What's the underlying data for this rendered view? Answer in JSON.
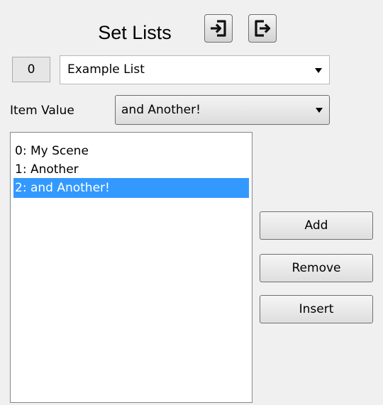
{
  "header": {
    "title": "Set Lists",
    "buttons": [
      {
        "icon": "import-icon"
      },
      {
        "icon": "export-icon"
      }
    ]
  },
  "list_selector": {
    "index": "0",
    "value": "Example List"
  },
  "item_value": {
    "label": "Item Value",
    "value": "and Another!"
  },
  "items": [
    {
      "label": "0: My Scene",
      "selected": false
    },
    {
      "label": "1: Another",
      "selected": false
    },
    {
      "label": "2: and Another!",
      "selected": true
    }
  ],
  "actions": {
    "add": "Add",
    "remove": "Remove",
    "insert": "Insert"
  },
  "colors": {
    "selection": "#3399ff",
    "background": "#f0f0f0"
  }
}
